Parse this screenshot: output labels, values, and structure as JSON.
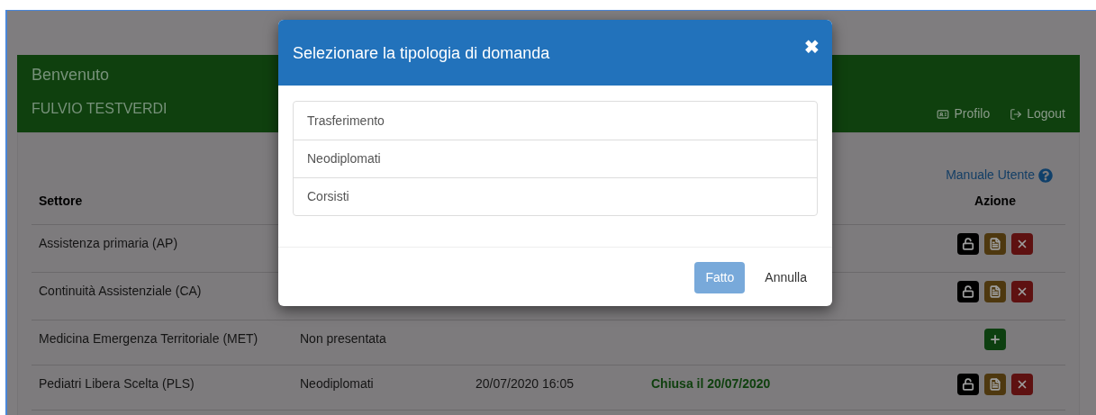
{
  "header": {
    "greeting": "Benvenuto",
    "user": "FULVIO TESTVERDI",
    "links": [
      {
        "kind": "profile",
        "label": "Profilo"
      },
      {
        "kind": "logout",
        "label": "Logout"
      }
    ]
  },
  "manual_link": "Manuale Utente",
  "table": {
    "columns": [
      {
        "label": "Settore"
      },
      {
        "label": "Azione"
      }
    ],
    "rows": [
      {
        "settore": "Assistenza primaria (AP)",
        "actions": [
          {
            "kind": "unlock"
          },
          {
            "kind": "pdf"
          },
          {
            "kind": "delete"
          }
        ]
      },
      {
        "settore": "Continuità Assistenziale (CA)",
        "actions": [
          {
            "kind": "unlock"
          },
          {
            "kind": "pdf"
          },
          {
            "kind": "delete"
          }
        ]
      },
      {
        "settore": "Medicina Emergenza Territoriale (MET)",
        "column_2": "Non presentata",
        "actions": [
          {
            "kind": "add"
          }
        ]
      },
      {
        "settore": "Pediatri Libera Scelta (PLS)",
        "column_2": "Neodiplomati",
        "column_3": "20/07/2020 16:05",
        "column_4": "Chiusa il 20/07/2020",
        "actions": [
          {
            "kind": "unlock"
          },
          {
            "kind": "pdf"
          },
          {
            "kind": "delete"
          }
        ]
      }
    ]
  },
  "modal": {
    "title": "Selezionare la tipologia di domanda",
    "close": "✖",
    "options": [
      "Trasferimento",
      "Neodiplomati",
      "Corsisti"
    ],
    "buttons": [
      {
        "kind": "primary",
        "label": "Fatto",
        "disabled": true
      },
      {
        "kind": "plain",
        "label": "Annulla",
        "disabled": false
      }
    ]
  }
}
